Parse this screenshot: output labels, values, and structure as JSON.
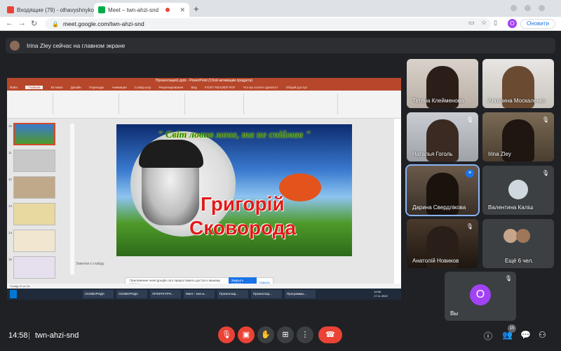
{
  "browser": {
    "tabs": [
      {
        "label": "Входящие (79) - olhavyshnyko",
        "icon": "gmail-icon",
        "close": "✕"
      },
      {
        "label": "Meet – twn-ahzi-snd",
        "icon": "meet-icon",
        "close": "✕"
      }
    ],
    "new_tab": "+",
    "url": "meet.google.com/twn-ahzi-snd",
    "profile_initial": "O",
    "update_label": "Оновити"
  },
  "presenter_banner": "Irina Zley сейчас на главном экране",
  "presentation": {
    "title": "Презентация1.pptx - PowerPoint (Сбой активации продукта)",
    "menu": [
      "Файл",
      "Главная",
      "Вставка",
      "Дизайн",
      "Переходы",
      "Анимация",
      "Слайд-шоу",
      "Рецензирование",
      "Вид",
      "FOXIT READER PDF",
      "Что вы хотите сделать?",
      "Общий доступ"
    ],
    "active_menu": "Главная",
    "slide_numbers": [
      "10",
      "11",
      "12",
      "13",
      "14",
      "15"
    ],
    "slide_quote": "\" Світ ловив мене, та не спіймав \"",
    "slide_name_line1": "Григорій",
    "slide_name_line2": "Сковорода",
    "notes": "Заметки к слайду",
    "share_banner": "Приложение meet.google.com предоставило доступ к вашему экрану.",
    "share_stop": "Закрыть доступ",
    "share_hide": "Скрыть",
    "status": "Слайд 10 из 16",
    "taskbar": [
      "СКОВОРОДА",
      "СКОВОРОДА",
      "ЛІТЕРАТУРН...",
      "Meet – twn-a...",
      "Презентаці...",
      "Презентаці...",
      "Программы..."
    ],
    "tray_time": "14:56",
    "tray_date": "17.11.2022"
  },
  "participants": [
    {
      "name": "Тетяна Клейменова",
      "muted": false
    },
    {
      "name": "Ангелина Москаленко",
      "muted": false
    },
    {
      "name": "Наталья Гоголь",
      "muted": true
    },
    {
      "name": "Irina Zley",
      "muted": true
    },
    {
      "name": "Дарина Свердлікова",
      "muted": false,
      "speaking": true
    },
    {
      "name": "Валентина Каліш",
      "muted": true
    },
    {
      "name": "Анатолій Новиков",
      "muted": true
    },
    {
      "name": "Ещё 6 чел.",
      "muted": false
    }
  ],
  "self": {
    "name": "Вы",
    "initial": "O"
  },
  "bottom": {
    "time": "14:58",
    "separator": "|",
    "meeting_code": "twn-ahzi-snd",
    "participants_count": "15"
  },
  "colors": {
    "meet_bg": "#202124",
    "tile_bg": "#3c4043",
    "danger": "#ea4335",
    "accent": "#a142f4",
    "powerpoint": "#b7472a"
  }
}
